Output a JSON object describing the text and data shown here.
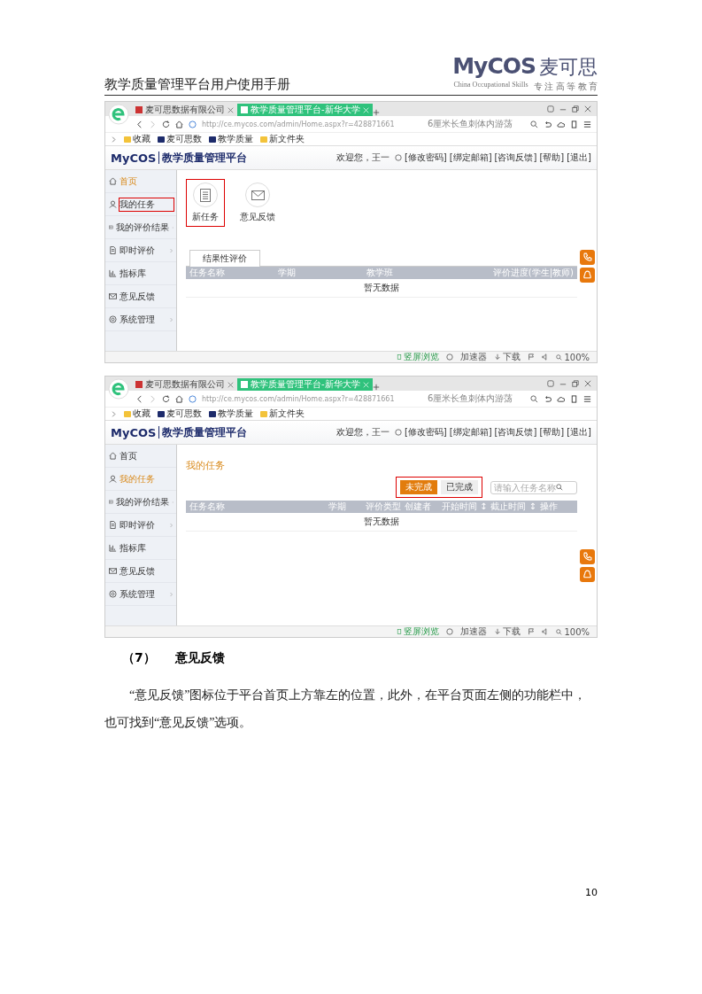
{
  "header": {
    "title": "教学质量管理平台用户使用手册",
    "logo_text": "MyCOS",
    "logo_cn": "麦可思",
    "logo_tagline": "China Occupational Skills",
    "logo_tagline_cn": "专 注 高 等 教 育"
  },
  "screenshots": [
    {
      "tabs": [
        {
          "label": "麦可思数据有限公司",
          "selected": false
        },
        {
          "label": "教学质量管理平台-新华大学",
          "selected": true
        }
      ],
      "url": "http://ce.mycos.com/admin/Home.aspx?r=428871661",
      "search_hint": "6厘米长鱼刺体内游荡",
      "bookmarks": [
        "收藏",
        "麦可思数",
        "教学质量",
        "新文件夹"
      ],
      "app_brand": "MyCOS",
      "app_title": "教学质量管理平台",
      "welcome": "欢迎您，王一",
      "user_links": [
        "[修改密码]",
        "[绑定邮箱]",
        "[咨询反馈]",
        "[帮助]",
        "[退出]"
      ],
      "sidebar": [
        {
          "label": "首页",
          "kind": "home",
          "selected": true,
          "highlighted": false,
          "has_arrow": false
        },
        {
          "label": "我的任务",
          "kind": "user",
          "selected": false,
          "highlighted": true,
          "has_arrow": false
        },
        {
          "label": "我的评价结果",
          "kind": "list",
          "selected": false,
          "highlighted": false,
          "has_arrow": true
        },
        {
          "label": "即时评价",
          "kind": "doc",
          "selected": false,
          "highlighted": false,
          "has_arrow": true
        },
        {
          "label": "指标库",
          "kind": "chart",
          "selected": false,
          "highlighted": false,
          "has_arrow": false
        },
        {
          "label": "意见反馈",
          "kind": "mail",
          "selected": false,
          "highlighted": false,
          "has_arrow": false
        },
        {
          "label": "系统管理",
          "kind": "gear",
          "selected": false,
          "highlighted": false,
          "has_arrow": true
        }
      ],
      "content": {
        "kind": "home",
        "shortcuts": [
          {
            "label": "新任务",
            "kind": "doc",
            "highlighted": true
          },
          {
            "label": "意见反馈",
            "kind": "mail",
            "highlighted": false
          }
        ],
        "tab": "结果性评价",
        "columns": [
          "任务名称",
          "学期",
          "教学班",
          "评价进度(学生|教师)"
        ],
        "empty": "暂无数据"
      },
      "status_bar": {
        "portrait": "竖屏浏览",
        "accelerator": "加速器",
        "download": "下载",
        "zoom": "100%"
      }
    },
    {
      "tabs": [
        {
          "label": "麦可思数据有限公司",
          "selected": false
        },
        {
          "label": "教学质量管理平台-新华大学",
          "selected": true
        }
      ],
      "url": "http://ce.mycos.com/admin/Home.aspx?r=428871661",
      "search_hint": "6厘米长鱼刺体内游荡",
      "bookmarks": [
        "收藏",
        "麦可思数",
        "教学质量",
        "新文件夹"
      ],
      "app_brand": "MyCOS",
      "app_title": "教学质量管理平台",
      "welcome": "欢迎您，王一",
      "user_links": [
        "[修改密码]",
        "[绑定邮箱]",
        "[咨询反馈]",
        "[帮助]",
        "[退出]"
      ],
      "sidebar": [
        {
          "label": "首页",
          "kind": "home",
          "selected": false,
          "highlighted": false,
          "has_arrow": false
        },
        {
          "label": "我的任务",
          "kind": "user",
          "selected": true,
          "highlighted": false,
          "has_arrow": false
        },
        {
          "label": "我的评价结果",
          "kind": "list",
          "selected": false,
          "highlighted": false,
          "has_arrow": true
        },
        {
          "label": "即时评价",
          "kind": "doc",
          "selected": false,
          "highlighted": false,
          "has_arrow": true
        },
        {
          "label": "指标库",
          "kind": "chart",
          "selected": false,
          "highlighted": false,
          "has_arrow": false
        },
        {
          "label": "意见反馈",
          "kind": "mail",
          "selected": false,
          "highlighted": false,
          "has_arrow": false
        },
        {
          "label": "系统管理",
          "kind": "gear",
          "selected": false,
          "highlighted": false,
          "has_arrow": true
        }
      ],
      "content": {
        "kind": "tasks",
        "title": "我的任务",
        "filters": [
          {
            "label": "未完成",
            "selected": true
          },
          {
            "label": "已完成",
            "selected": false
          }
        ],
        "filters_highlighted": true,
        "search_placeholder": "请输入任务名称",
        "columns": [
          "任务名称",
          "学期",
          "评价类型",
          "创建者",
          "开始时间 ↕",
          "截止时间 ↕",
          "操作"
        ],
        "empty": "暂无数据"
      },
      "status_bar": {
        "portrait": "竖屏浏览",
        "accelerator": "加速器",
        "download": "下载",
        "zoom": "100%"
      }
    }
  ],
  "section": {
    "number": "（7）",
    "title": "意见反馈"
  },
  "paragraph": "“意见反馈”图标位于平台首页上方靠左的位置，此外，在平台页面左侧的功能栏中，也可找到“意见反馈”选项。",
  "page_number": "10"
}
